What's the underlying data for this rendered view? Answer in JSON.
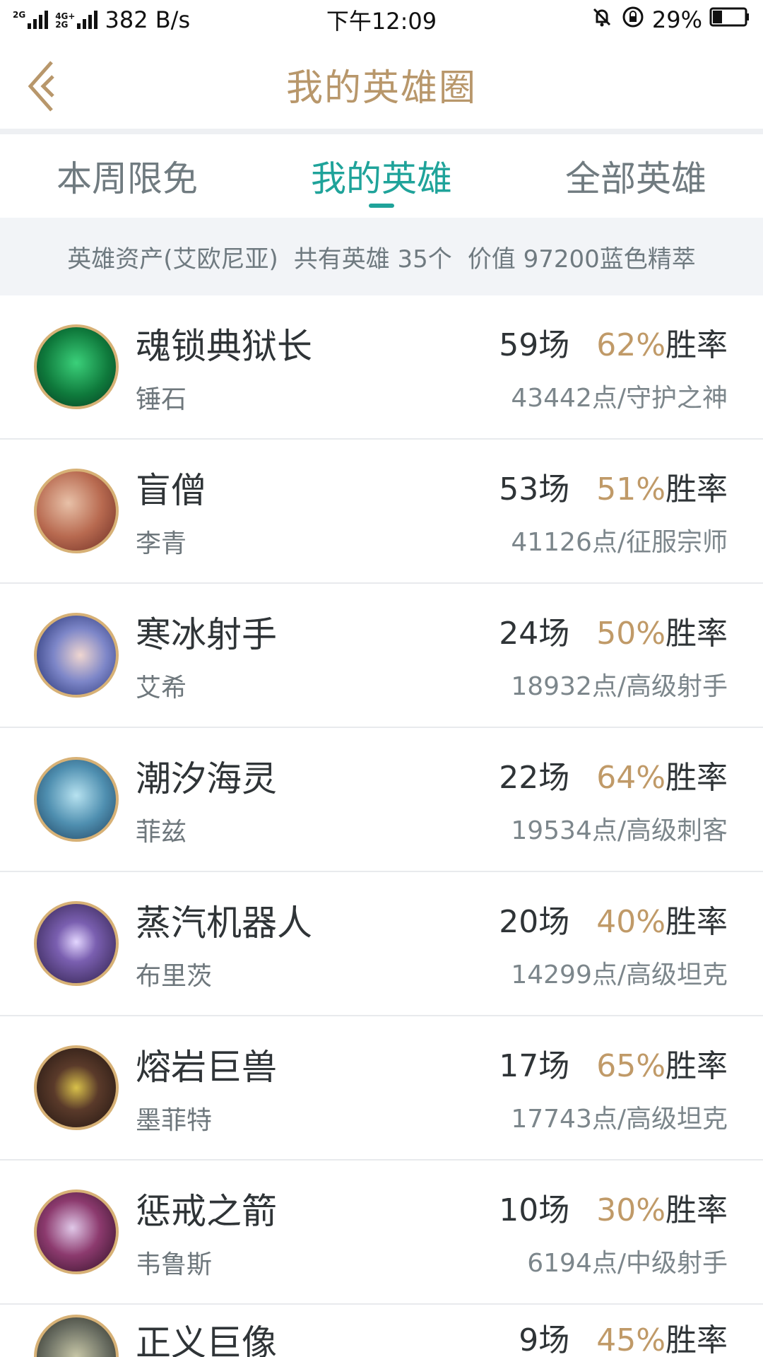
{
  "status_bar": {
    "net_type_top": "2G",
    "net_type_mid": "4G+",
    "net_type_bottom": "2G",
    "speed": "382 B/s",
    "time": "下午12:09",
    "battery": "29%"
  },
  "header": {
    "title": "我的英雄圈"
  },
  "tabs": [
    {
      "label": "本周限免"
    },
    {
      "label": "我的英雄"
    },
    {
      "label": "全部英雄"
    }
  ],
  "summary": {
    "region": "英雄资产(艾欧尼亚)",
    "count": "共有英雄 35个",
    "value": "价值 97200蓝色精萃"
  },
  "heroes": [
    {
      "title": "魂锁典狱长",
      "name": "锤石",
      "matches": "59场",
      "winrate": "62%",
      "win_label": "胜率",
      "points": "43442点/守护之神",
      "avatar_color": "#1b9e54"
    },
    {
      "title": "盲僧",
      "name": "李青",
      "matches": "53场",
      "winrate": "51%",
      "win_label": "胜率",
      "points": "41126点/征服宗师",
      "avatar_color": "#c98870"
    },
    {
      "title": "寒冰射手",
      "name": "艾希",
      "matches": "24场",
      "winrate": "50%",
      "win_label": "胜率",
      "points": "18932点/高级射手",
      "avatar_color": "#4c5aa8"
    },
    {
      "title": "潮汐海灵",
      "name": "菲兹",
      "matches": "22场",
      "winrate": "64%",
      "win_label": "胜率",
      "points": "19534点/高级刺客",
      "avatar_color": "#4f8fb0"
    },
    {
      "title": "蒸汽机器人",
      "name": "布里茨",
      "matches": "20场",
      "winrate": "40%",
      "win_label": "胜率",
      "points": "14299点/高级坦克",
      "avatar_color": "#4d3b6e"
    },
    {
      "title": "熔岩巨兽",
      "name": "墨菲特",
      "matches": "17场",
      "winrate": "65%",
      "win_label": "胜率",
      "points": "17743点/高级坦克",
      "avatar_color": "#3b2c24"
    },
    {
      "title": "惩戒之箭",
      "name": "韦鲁斯",
      "matches": "10场",
      "winrate": "30%",
      "win_label": "胜率",
      "points": "6194点/中级射手",
      "avatar_color": "#5c2b4d"
    },
    {
      "title": "正义巨像",
      "name": "",
      "matches": "9场",
      "winrate": "45%",
      "win_label": "胜率",
      "points": "",
      "avatar_color": "#6b6f63"
    }
  ]
}
